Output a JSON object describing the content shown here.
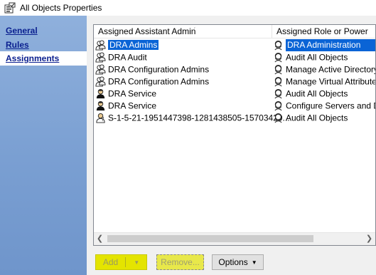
{
  "window": {
    "title": "All Objects Properties",
    "icon": "properties-icon"
  },
  "sidebar": {
    "items": [
      {
        "label": "General",
        "selected": false
      },
      {
        "label": "Rules",
        "selected": false
      },
      {
        "label": "Assignments",
        "selected": true
      }
    ]
  },
  "list": {
    "columns": [
      "Assigned Assistant Admin",
      "Assigned Role or Power"
    ],
    "rows": [
      {
        "admin": "DRA Admins",
        "admin_icon": "group-icon",
        "role": "DRA Administration",
        "selected": true
      },
      {
        "admin": "DRA Audit",
        "admin_icon": "group-icon",
        "role": "Audit All Objects",
        "selected": false
      },
      {
        "admin": "DRA Configuration Admins",
        "admin_icon": "group-icon",
        "role": "Manage Active Directory",
        "selected": false
      },
      {
        "admin": "DRA Configuration Admins",
        "admin_icon": "group-icon",
        "role": "Manage Virtual Attributes",
        "selected": false
      },
      {
        "admin": "DRA Service",
        "admin_icon": "user-icon",
        "role": "Audit All Objects",
        "selected": false
      },
      {
        "admin": "DRA Service",
        "admin_icon": "user-icon",
        "role": "Configure Servers and Do",
        "selected": false
      },
      {
        "admin": "S-1-5-21-1951447398-1281438505-15703429...",
        "admin_icon": "unknown-user-icon",
        "role": "Audit All Objects",
        "selected": false
      }
    ]
  },
  "buttons": {
    "add": "Add",
    "remove": "Remove...",
    "options": "Options"
  },
  "colors": {
    "selection": "#0a64d6",
    "sidebar": "#7a9fd2",
    "highlight": "#e4e400"
  }
}
